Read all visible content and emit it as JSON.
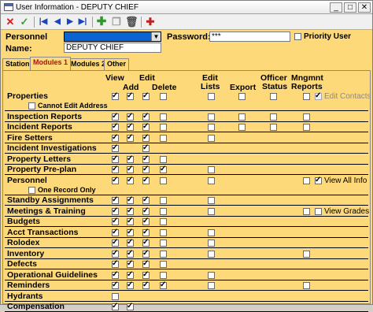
{
  "window": {
    "title": "User Information - DEPUTY CHIEF",
    "controls": [
      "_",
      "□",
      "✕"
    ]
  },
  "form": {
    "personnel_label": "Personnel",
    "name_label": "Name:",
    "name_value": "DEPUTY CHIEF",
    "password_label": "Password:",
    "password_value": "***",
    "priority_label": "Priority User"
  },
  "tabs": [
    "Station",
    "Modules 1",
    "Modules 2",
    "Other"
  ],
  "headers": {
    "view": "View",
    "edit": "Edit",
    "add": "Add",
    "delete": "Delete",
    "edit_lists_1": "Edit",
    "edit_lists_2": "Lists",
    "export": "Export",
    "officer_1": "Officer",
    "officer_2": "Status",
    "mngmnt_1": "Mngmnt",
    "mngmnt_2": "Reports"
  },
  "rows": [
    {
      "label": "Properties",
      "view": true,
      "add": true,
      "edit": true,
      "del": false,
      "lists": false,
      "export": false,
      "officer": false,
      "mngmnt": false,
      "extra": "Edit Contacts",
      "extra_checked": true,
      "extra_disabled": true,
      "sub": "Cannot Edit Address"
    },
    {
      "label": "Inspection Reports",
      "view": true,
      "add": true,
      "edit": true,
      "del": false,
      "lists": false,
      "export": false,
      "officer": false,
      "mngmnt": false
    },
    {
      "label": "Incident Reports",
      "view": true,
      "add": true,
      "edit": true,
      "del": false,
      "lists": false,
      "export": false,
      "officer": false,
      "mngmnt": false
    },
    {
      "label": "Fire Setters",
      "view": true,
      "add": true,
      "edit": true,
      "del": false,
      "lists": false
    },
    {
      "label": "Incident Investigations",
      "view": true,
      "edit": true
    },
    {
      "label": "Property Letters",
      "view": true,
      "add": true,
      "edit": true,
      "del": false
    },
    {
      "label": "Property Pre-plan",
      "view": true,
      "add": true,
      "edit": true,
      "del": true,
      "lists": false
    },
    {
      "label": "Personnel",
      "view": true,
      "add": true,
      "edit": true,
      "del": false,
      "lists": false,
      "mngmnt": false,
      "extra": "View All Info",
      "extra_checked": true,
      "sub": "One Record Only"
    },
    {
      "label": "Standby Assignments",
      "view": true,
      "add": true,
      "edit": true,
      "del": false,
      "lists": false
    },
    {
      "label": "Meetings & Training",
      "view": true,
      "add": true,
      "edit": true,
      "del": false,
      "lists": false,
      "mngmnt": false,
      "extra": "View Grades",
      "extra_checked": false
    },
    {
      "label": "Budgets",
      "view": true,
      "add": true,
      "edit": true,
      "del": false
    },
    {
      "label": "Acct Transactions",
      "view": true,
      "add": true,
      "edit": true,
      "del": false,
      "lists": false
    },
    {
      "label": "Rolodex",
      "view": true,
      "add": true,
      "edit": true,
      "del": false,
      "lists": false
    },
    {
      "label": "Inventory",
      "view": true,
      "add": true,
      "edit": true,
      "del": false,
      "lists": false,
      "mngmnt": false
    },
    {
      "label": "Defects",
      "view": true,
      "add": true,
      "edit": true,
      "del": false
    },
    {
      "label": "Operational Guidelines",
      "view": true,
      "add": true,
      "edit": true,
      "del": false,
      "lists": false
    },
    {
      "label": "Reminders",
      "view": true,
      "add": true,
      "edit": true,
      "del": true,
      "lists": false,
      "mngmnt": false
    },
    {
      "label": "Hydrants",
      "view": false
    },
    {
      "label": "Compensation",
      "view": true,
      "add": true
    }
  ]
}
